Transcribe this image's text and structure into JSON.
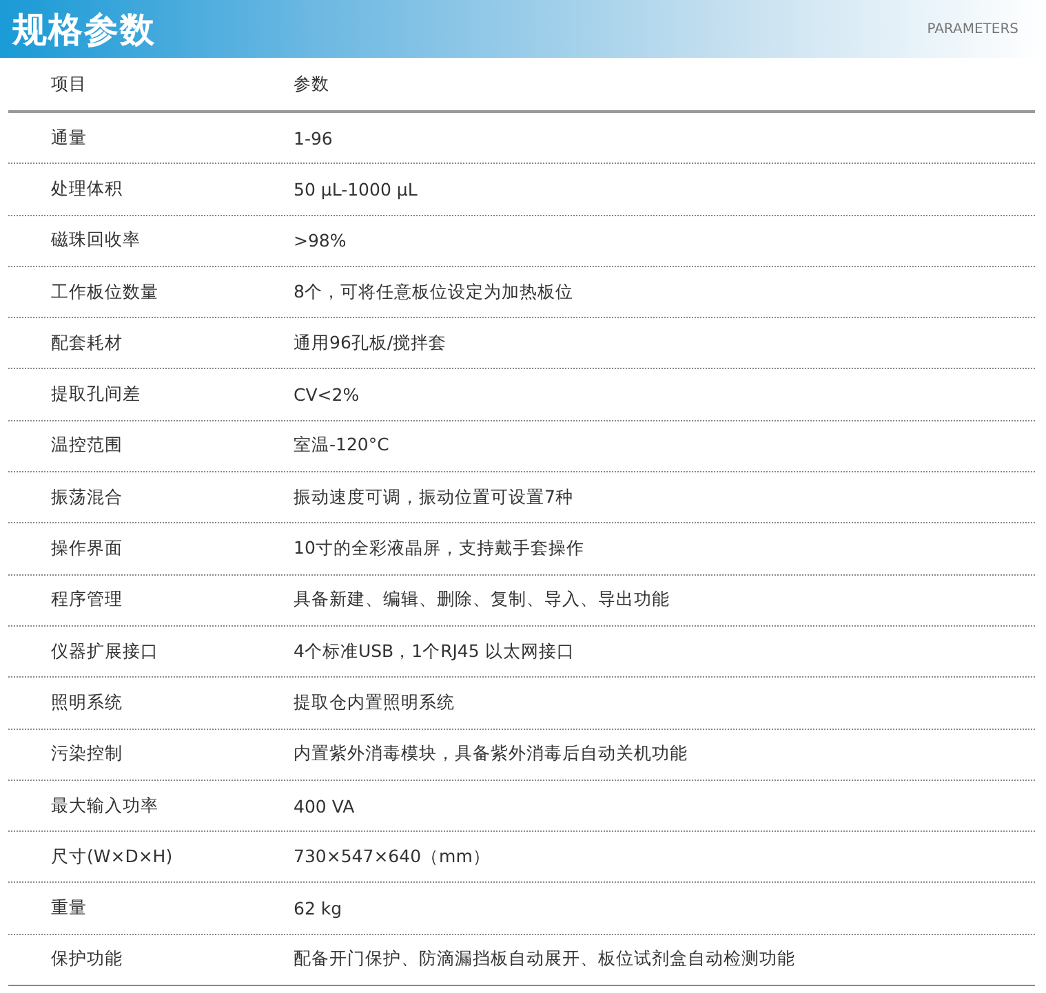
{
  "banner": {
    "title": "规格参数",
    "subtitle": "PARAMETERS"
  },
  "table": {
    "columns": [
      "项目",
      "参数"
    ],
    "rows": [
      {
        "item": "通量",
        "value": "1-96"
      },
      {
        "item": "处理体积",
        "value": "50 μL-1000 μL"
      },
      {
        "item": "磁珠回收率",
        "value": ">98%"
      },
      {
        "item": "工作板位数量",
        "value": "8个，可将任意板位设定为加热板位"
      },
      {
        "item": "配套耗材",
        "value": "通用96孔板/搅拌套"
      },
      {
        "item": "提取孔间差",
        "value": "CV<2%"
      },
      {
        "item": "温控范围",
        "value": "室温-120°C"
      },
      {
        "item": "振荡混合",
        "value": "振动速度可调，振动位置可设置7种"
      },
      {
        "item": "操作界面",
        "value": "10寸的全彩液晶屏，支持戴手套操作"
      },
      {
        "item": "程序管理",
        "value": "具备新建、编辑、删除、复制、导入、导出功能"
      },
      {
        "item": "仪器扩展接口",
        "value": "4个标准USB，1个RJ45 以太网接口"
      },
      {
        "item": "照明系统",
        "value": "提取仓内置照明系统"
      },
      {
        "item": "污染控制",
        "value": "内置紫外消毒模块，具备紫外消毒后自动关机功能"
      },
      {
        "item": "最大输入功率",
        "value": "400 VA"
      },
      {
        "item": "尺寸(W×D×H)",
        "value": "730×547×640（mm）"
      },
      {
        "item": "重量",
        "value": "62 kg"
      },
      {
        "item": "保护功能",
        "value": "配备开门保护、防滴漏挡板自动展开、板位试剂盒自动检测功能"
      }
    ]
  }
}
